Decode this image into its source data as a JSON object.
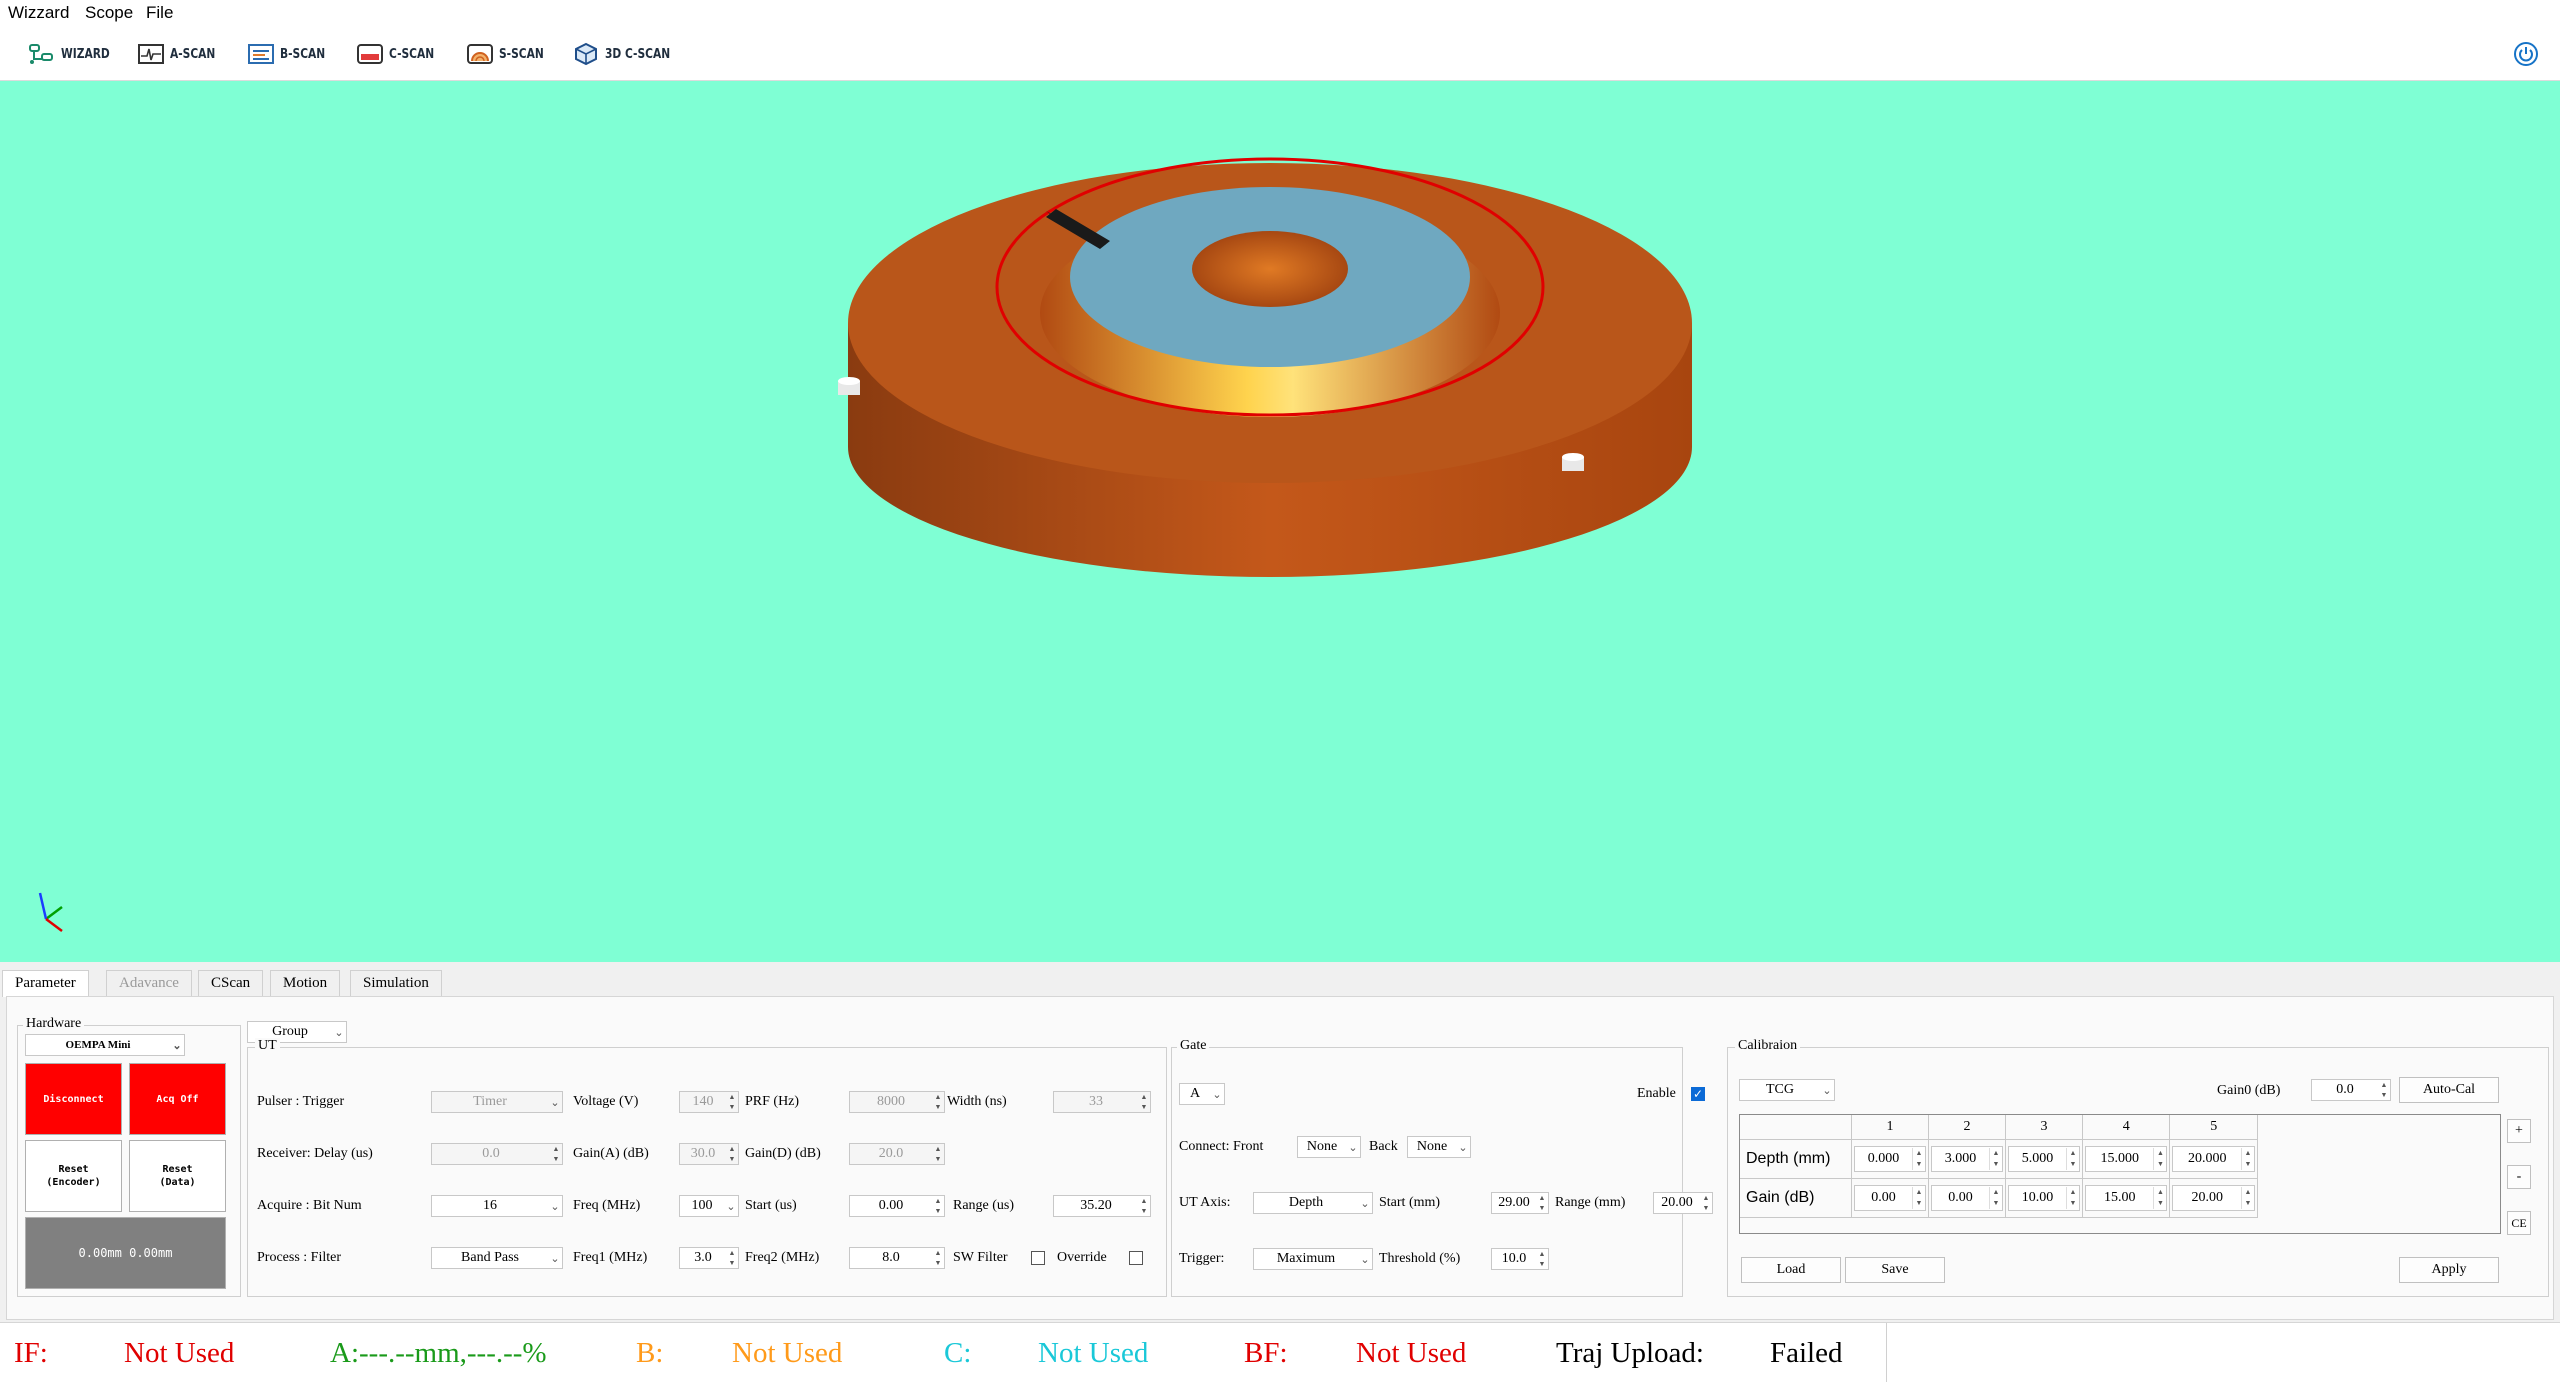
{
  "menu": [
    "Wizzard",
    "Scope",
    "File"
  ],
  "toolbar": {
    "buttons": [
      {
        "label": "WIZARD",
        "icon": "wizard-icon"
      },
      {
        "label": "A-SCAN",
        "icon": "ascan-icon"
      },
      {
        "label": "B-SCAN",
        "icon": "bscan-icon"
      },
      {
        "label": "C-SCAN",
        "icon": "cscan-icon"
      },
      {
        "label": "S-SCAN",
        "icon": "sscan-icon"
      },
      {
        "label": "3D C-SCAN",
        "icon": "3d-cscan-icon"
      }
    ],
    "power_icon": "power-icon"
  },
  "colors": {
    "viewport_bg": "#7fffd4",
    "part_body": "#d96a1f",
    "part_face": "#6fa8c0",
    "scan_path": "#e00000",
    "accent_red": "#ff0000"
  },
  "tabs": [
    {
      "label": "Parameter",
      "state": "active"
    },
    {
      "label": "Adavance",
      "state": "disabled"
    },
    {
      "label": "CScan",
      "state": "normal"
    },
    {
      "label": "Motion",
      "state": "normal"
    },
    {
      "label": "Simulation",
      "state": "normal"
    }
  ],
  "hardware": {
    "title": "Hardware",
    "device": "OEMPA Mini",
    "disconnect": "Disconnect",
    "acq": "Acq Off",
    "reset_encoder": "Reset\n(Encoder)",
    "reset_data": "Reset\n(Data)",
    "position": "0.00mm 0.00mm"
  },
  "group_select": "Group",
  "ut": {
    "title": "UT",
    "pulser_label": "Pulser  : Trigger",
    "trigger": "Timer",
    "voltage_label": "Voltage  (V)",
    "voltage": "140",
    "prf_label": "PRF      (Hz)",
    "prf": "8000",
    "width_label": "Width  (ns)",
    "width": "33",
    "receiver_label": "Receiver: Delay (us)",
    "delay": "0.0",
    "gaina_label": "Gain(A) (dB)",
    "gaina": "30.0",
    "gaind_label": "Gain(D) (dB)",
    "gaind": "20.0",
    "acquire_label": "Acquire : Bit Num",
    "bitnum": "16",
    "freq_label": "Freq    (MHz)",
    "freq": "100",
    "start_label": "Start    (us)",
    "start": "0.00",
    "range_label": "Range  (us)",
    "range": "35.20",
    "process_label": "Process : Filter",
    "filter": "Band Pass",
    "freq1_label": "Freq1   (MHz)",
    "freq1": "3.0",
    "freq2_label": "Freq2  (MHz)",
    "freq2": "8.0",
    "swfilter_label": "SW Filter",
    "override_label": "Override"
  },
  "gate": {
    "title": "Gate",
    "select": "A",
    "enable_label": "Enable",
    "connect_label": "Connect: Front",
    "front": "None",
    "back_label": "Back",
    "back": "None",
    "axis_label": "UT Axis:",
    "axis": "Depth",
    "start_label": "Start     (mm)",
    "start": "29.00",
    "range_label": "Range   (mm)",
    "range": "20.00",
    "trigger_label": "Trigger:",
    "trigger": "Maximum",
    "threshold_label": "Threshold (%)",
    "threshold": "10.0"
  },
  "calibration": {
    "title": "Calibraion",
    "mode": "TCG",
    "gain0_label": "Gain0 (dB)",
    "gain0": "0.0",
    "autocal": "Auto-Cal",
    "columns": [
      "1",
      "2",
      "3",
      "4",
      "5"
    ],
    "depth_label": "Depth (mm)",
    "gain_label": "Gain (dB)",
    "depth": [
      "0.000",
      "3.000",
      "5.000",
      "15.000",
      "20.000"
    ],
    "gain": [
      "0.00",
      "0.00",
      "10.00",
      "15.00",
      "20.00"
    ],
    "add": "+",
    "remove": "-",
    "ce": "CE",
    "load": "Load",
    "save": "Save",
    "apply": "Apply"
  },
  "status": {
    "if_label": "IF:",
    "if_value": "Not Used",
    "a_value": "A:---.--mm,---.--%",
    "b_label": "B:",
    "b_value": "Not Used",
    "c_label": "C:",
    "c_value": "Not Used",
    "bf_label": "BF:",
    "bf_value": "Not Used",
    "traj_label": "Traj Upload:",
    "traj_value": "Failed"
  }
}
